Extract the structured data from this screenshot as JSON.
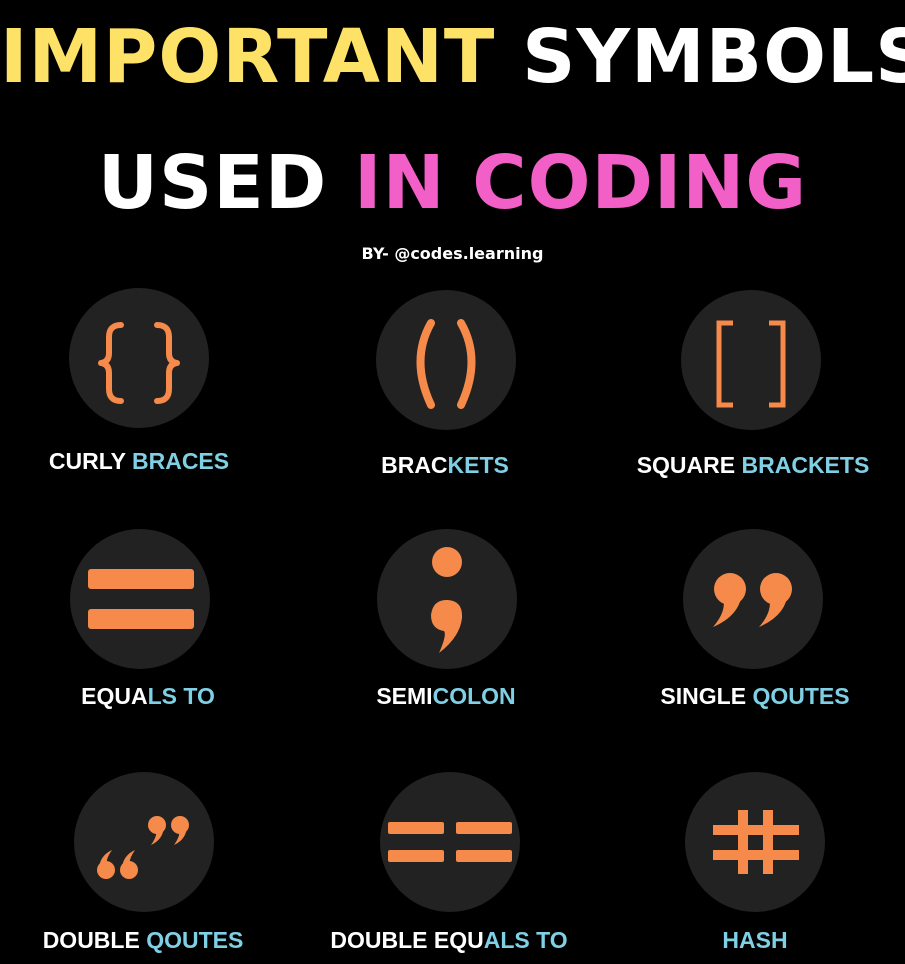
{
  "title": {
    "line1": {
      "part1": "IMPORTANT",
      "part2": "SYMBOLS"
    },
    "line2": {
      "part1": "USED",
      "part2": "IN CODING"
    }
  },
  "byline": "BY- @codes.learning",
  "colors": {
    "background": "#000000",
    "title_yellow": "#fde267",
    "title_white": "#ffffff",
    "title_pink": "#f25fc7",
    "icon_circle": "#222222",
    "symbol_orange": "#f58a4a",
    "label_white": "#ffffff",
    "label_blue": "#7fd0e4"
  },
  "symbols": [
    {
      "icon": "curly-braces-icon",
      "label_white": "CURLY ",
      "label_blue": "BRACES"
    },
    {
      "icon": "parentheses-icon",
      "label_white": "BRAC",
      "label_blue": "KETS"
    },
    {
      "icon": "square-brackets-icon",
      "label_white": "SQUARE ",
      "label_blue": "BRACKETS"
    },
    {
      "icon": "equals-icon",
      "label_white": "EQUA",
      "label_blue": "LS TO"
    },
    {
      "icon": "semicolon-icon",
      "label_white": "SEMI",
      "label_blue": "COLON"
    },
    {
      "icon": "single-quotes-icon",
      "label_white": "SINGLE ",
      "label_blue": "QOUTES"
    },
    {
      "icon": "double-quotes-icon",
      "label_white": "DOUBLE ",
      "label_blue": "QOUTES"
    },
    {
      "icon": "double-equals-icon",
      "label_white": "DOUBLE EQU",
      "label_blue": "ALS TO"
    },
    {
      "icon": "hash-icon",
      "label_white": "",
      "label_blue": "HASH"
    }
  ]
}
